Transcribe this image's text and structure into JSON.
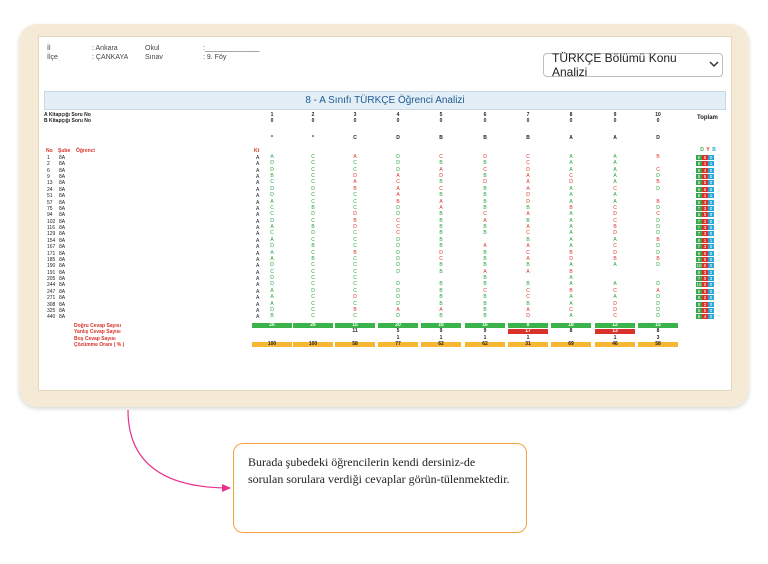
{
  "info": {
    "il_label": "İl",
    "il_value": ": Ankara",
    "okul_label": "Okul",
    "okul_value": ":______________",
    "ilce_label": "İlçe",
    "ilce_value": ": ÇANKAYA",
    "sinav_label": "Sınav",
    "sinav_value": ": 9. Föy"
  },
  "dropdown": {
    "label": "TÜRKÇE Bölümü Konu Analizi"
  },
  "table_title": "8 - A Sınıfı TÜRKÇE Öğrenci Analizi",
  "header": {
    "a_label": "A Kitapçığı Soru No",
    "b_label": "B Kitapçığı Soru No",
    "a_numbers": [
      "1",
      "2",
      "3",
      "4",
      "5",
      "6",
      "7",
      "8",
      "9",
      "10"
    ],
    "b_numbers": [
      "0",
      "0",
      "0",
      "0",
      "0",
      "0",
      "0",
      "0",
      "0",
      "0"
    ],
    "answer_key": [
      "*",
      "*",
      "C",
      "D",
      "B",
      "B",
      "B",
      "A",
      "A",
      "D"
    ],
    "toplam": "Toplam",
    "no": "No",
    "sube": "Şube",
    "ogrenci": "Öğrenci",
    "kt": "Kt",
    "dyb": [
      "D",
      "Y",
      "B"
    ]
  },
  "students": [
    {
      "no": "1",
      "sube": "8A",
      "kt": "A",
      "answers": [
        "A",
        "C",
        "A",
        "D",
        "C",
        "D",
        "C",
        "A",
        "A",
        "B"
      ],
      "d": "5",
      "y": "5",
      "b": "0"
    },
    {
      "no": "2",
      "sube": "8A",
      "kt": "A",
      "answers": [
        "D",
        "C",
        "C",
        "D",
        "B",
        "B",
        "C",
        "A",
        "A",
        ""
      ],
      "d": "8",
      "y": "1",
      "b": "1"
    },
    {
      "no": "6",
      "sube": "8A",
      "kt": "A",
      "answers": [
        "D",
        "C",
        "C",
        "D",
        "A",
        "C",
        "D",
        "A",
        "A",
        "C"
      ],
      "d": "6",
      "y": "4",
      "b": "0"
    },
    {
      "no": "9",
      "sube": "8A",
      "kt": "A",
      "answers": [
        "B",
        "C",
        "D",
        "A",
        "D",
        "B",
        "A",
        "C",
        "A",
        "D"
      ],
      "d": "5",
      "y": "5",
      "b": "0"
    },
    {
      "no": "13",
      "sube": "8A",
      "kt": "A",
      "answers": [
        "C",
        "C",
        "A",
        "C",
        "B",
        "D",
        "A",
        "D",
        "A",
        "B"
      ],
      "d": "5",
      "y": "5",
      "b": "0"
    },
    {
      "no": "24",
      "sube": "8A",
      "kt": "A",
      "answers": [
        "D",
        "D",
        "B",
        "A",
        "C",
        "B",
        "A",
        "A",
        "C",
        "D"
      ],
      "d": "5",
      "y": "5",
      "b": "0"
    },
    {
      "no": "51",
      "sube": "8A",
      "kt": "A",
      "answers": [
        "D",
        "C",
        "C",
        "A",
        "B",
        "B",
        "D",
        "A",
        "A",
        ""
      ],
      "d": "8",
      "y": "1",
      "b": "1"
    },
    {
      "no": "57",
      "sube": "8A",
      "kt": "A",
      "answers": [
        "A",
        "C",
        "C",
        "B",
        "A",
        "B",
        "D",
        "A",
        "A",
        "B"
      ],
      "d": "6",
      "y": "4",
      "b": "0"
    },
    {
      "no": "75",
      "sube": "8A",
      "kt": "A",
      "answers": [
        "C",
        "B",
        "C",
        "D",
        "A",
        "B",
        "B",
        "B",
        "C",
        "D"
      ],
      "d": "7",
      "y": "3",
      "b": "0"
    },
    {
      "no": "94",
      "sube": "8A",
      "kt": "A",
      "answers": [
        "C",
        "D",
        "D",
        "D",
        "B",
        "C",
        "A",
        "A",
        "D",
        "C"
      ],
      "d": "5",
      "y": "5",
      "b": "0"
    },
    {
      "no": "102",
      "sube": "8A",
      "kt": "A",
      "answers": [
        "D",
        "C",
        "B",
        "C",
        "B",
        "A",
        "B",
        "A",
        "C",
        "D"
      ],
      "d": "7",
      "y": "3",
      "b": "0"
    },
    {
      "no": "116",
      "sube": "8A",
      "kt": "A",
      "answers": [
        "A",
        "B",
        "D",
        "C",
        "B",
        "B",
        "A",
        "A",
        "B",
        "D"
      ],
      "d": "7",
      "y": "3",
      "b": "0"
    },
    {
      "no": "129",
      "sube": "8A",
      "kt": "A",
      "answers": [
        "C",
        "D",
        "C",
        "C",
        "B",
        "B",
        "C",
        "A",
        "D",
        "D"
      ],
      "d": "7",
      "y": "3",
      "b": "0"
    },
    {
      "no": "154",
      "sube": "8A",
      "kt": "A",
      "answers": [
        "A",
        "C",
        "C",
        "D",
        "B",
        "",
        "B",
        "A",
        "A",
        "B"
      ],
      "d": "8",
      "y": "1",
      "b": "1"
    },
    {
      "no": "167",
      "sube": "8A",
      "kt": "A",
      "answers": [
        "D",
        "B",
        "C",
        "D",
        "B",
        "A",
        "A",
        "A",
        "C",
        "D"
      ],
      "d": "7",
      "y": "3",
      "b": "0"
    },
    {
      "no": "171",
      "sube": "8A",
      "kt": "A",
      "answers": [
        "A",
        "C",
        "B",
        "D",
        "D",
        "B",
        "C",
        "B",
        "D",
        "D"
      ],
      "d": "5",
      "y": "5",
      "b": "0"
    },
    {
      "no": "185",
      "sube": "8A",
      "kt": "A",
      "answers": [
        "A",
        "B",
        "C",
        "D",
        "C",
        "B",
        "A",
        "D",
        "B",
        "B"
      ],
      "d": "5",
      "y": "5",
      "b": "0"
    },
    {
      "no": "190",
      "sube": "8A",
      "kt": "A",
      "answers": [
        "D",
        "C",
        "C",
        "D",
        "B",
        "B",
        "B",
        "A",
        "A",
        "D"
      ],
      "d": "10",
      "y": "0",
      "b": "0"
    },
    {
      "no": "191",
      "sube": "8A",
      "kt": "A",
      "answers": [
        "C",
        "C",
        "C",
        "D",
        "B",
        "A",
        "A",
        "B",
        "",
        ""
      ],
      "d": "5",
      "y": "3",
      "b": "2"
    },
    {
      "no": "205",
      "sube": "8A",
      "kt": "A",
      "answers": [
        "D",
        "C",
        "C",
        "",
        "",
        "B",
        "",
        "A",
        "",
        ""
      ],
      "d": "7",
      "y": "0",
      "b": "3"
    },
    {
      "no": "244",
      "sube": "8A",
      "kt": "A",
      "answers": [
        "D",
        "C",
        "C",
        "D",
        "B",
        "B",
        "B",
        "A",
        "A",
        "D"
      ],
      "d": "10",
      "y": "0",
      "b": "0"
    },
    {
      "no": "247",
      "sube": "8A",
      "kt": "A",
      "answers": [
        "A",
        "D",
        "C",
        "D",
        "B",
        "C",
        "C",
        "B",
        "C",
        "A"
      ],
      "d": "5",
      "y": "5",
      "b": "0"
    },
    {
      "no": "271",
      "sube": "8A",
      "kt": "A",
      "answers": [
        "A",
        "C",
        "D",
        "D",
        "B",
        "B",
        "C",
        "A",
        "A",
        "D"
      ],
      "d": "8",
      "y": "2",
      "b": "0"
    },
    {
      "no": "308",
      "sube": "8A",
      "kt": "A",
      "answers": [
        "A",
        "C",
        "C",
        "D",
        "B",
        "B",
        "B",
        "A",
        "D",
        "D"
      ],
      "d": "8",
      "y": "2",
      "b": "0"
    },
    {
      "no": "325",
      "sube": "8A",
      "kt": "A",
      "answers": [
        "D",
        "C",
        "B",
        "A",
        "A",
        "B",
        "A",
        "C",
        "D",
        "D"
      ],
      "d": "5",
      "y": "5",
      "b": "0"
    },
    {
      "no": "440",
      "sube": "8A",
      "kt": "A",
      "answers": [
        "B",
        "C",
        "C",
        "D",
        "B",
        "B",
        "D",
        "A",
        "C",
        "D"
      ],
      "d": "6",
      "y": "4",
      "b": "0"
    }
  ],
  "summary": {
    "dogru_label": "Doğru Cevap Sayısı",
    "yanlis_label": "Yanlış Cevap Sayısı",
    "bos_label": "Boş Cevap Sayısı",
    "cozum_label": "Çözümme Oranı ( % )",
    "dogru": [
      "26",
      "26",
      "15",
      "20",
      "16",
      "16",
      "8",
      "18",
      "12",
      "15"
    ],
    "yanlis": [
      "",
      "",
      "11",
      "5",
      "9",
      "9",
      "17",
      "8",
      "13",
      "8"
    ],
    "bos": [
      "",
      "",
      "",
      "1",
      "1",
      "1",
      "1",
      "",
      "1",
      "3"
    ],
    "oran": [
      "100",
      "100",
      "58",
      "77",
      "62",
      "62",
      "31",
      "69",
      "46",
      "58"
    ]
  },
  "callout": {
    "text": "Burada şubedeki öğrencilerin kendi dersiniz-de sorulan sorulara verdiği cevaplar görün-tülenmektedir."
  },
  "colors": {
    "correct": "#23a03a",
    "wrong": "#d9322a",
    "sum_green": "#3ab44a",
    "sum_red": "#d9322a",
    "sum_orange": "#f7b733",
    "d_col": "#3aa54a",
    "y_col": "#d9322a",
    "b_col": "#29a8d8",
    "callout_border": "#f0a33c",
    "arrow": "#e8318c"
  }
}
